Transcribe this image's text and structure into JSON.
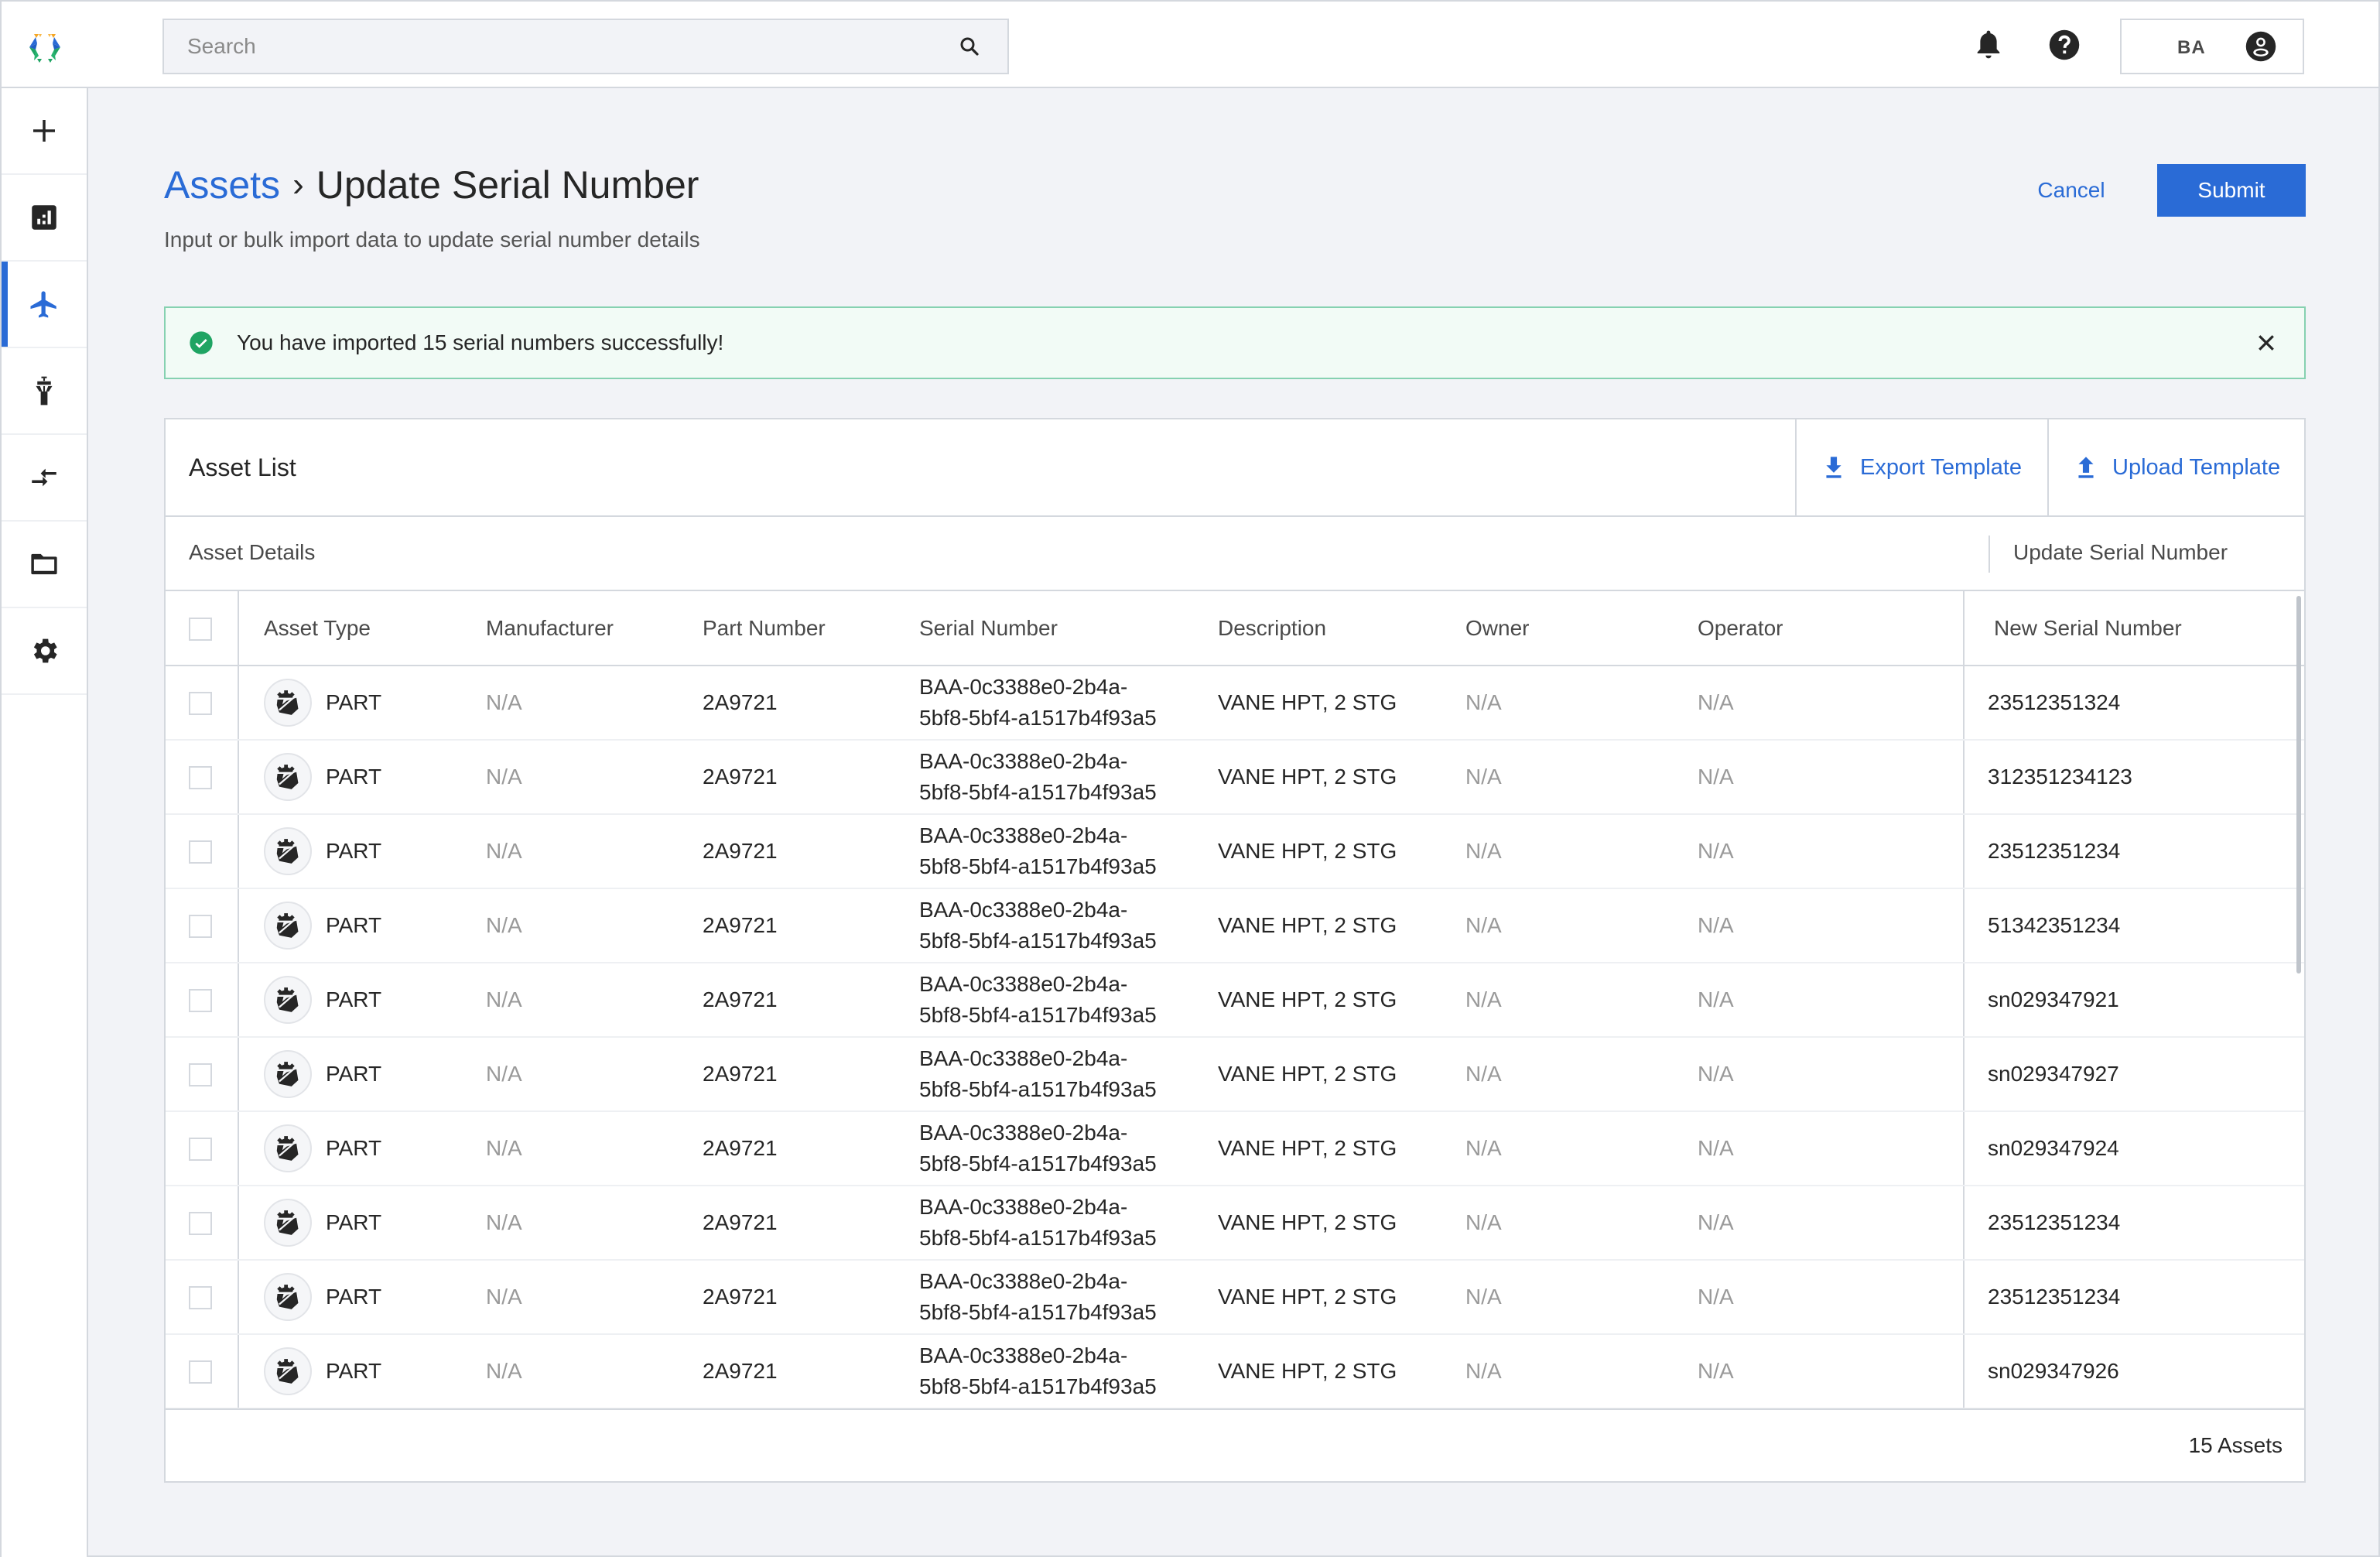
{
  "topbar": {
    "search_placeholder": "Search",
    "user_initials": "BA"
  },
  "sidebar": {
    "items": [
      {
        "name": "add",
        "icon": "plus-icon",
        "active": false
      },
      {
        "name": "dashboard",
        "icon": "chart-icon",
        "active": false
      },
      {
        "name": "flights",
        "icon": "airplane-icon",
        "active": true
      },
      {
        "name": "airports",
        "icon": "control-tower-icon",
        "active": false
      },
      {
        "name": "transfers",
        "icon": "swap-arrows-icon",
        "active": false
      },
      {
        "name": "files",
        "icon": "folder-icon",
        "active": false
      },
      {
        "name": "settings",
        "icon": "gear-icon",
        "active": false
      }
    ]
  },
  "header": {
    "breadcrumb_parent": "Assets",
    "breadcrumb_separator": "›",
    "title": "Update Serial Number",
    "subtitle": "Input or bulk import data to update serial number details",
    "cancel_label": "Cancel",
    "submit_label": "Submit"
  },
  "alert": {
    "message": "You have imported 15 serial numbers successfully!",
    "type": "success",
    "color": "#1fa463"
  },
  "card": {
    "title": "Asset List",
    "export_label": "Export Template",
    "upload_label": "Upload Template",
    "group_left": "Asset Details",
    "group_right": "Update Serial Number",
    "footer_count": "15 Assets"
  },
  "table": {
    "columns": [
      "Asset Type",
      "Manufacturer",
      "Part Number",
      "Serial Number",
      "Description",
      "Owner",
      "Operator",
      "New Serial Number"
    ],
    "rows": [
      {
        "type": "PART",
        "manufacturer": "N/A",
        "part": "2A9721",
        "serial_line1": "BAA-0c3388e0-2b4a-",
        "serial_line2": "5bf8-5bf4-a1517b4f93a5",
        "description": "VANE HPT, 2 STG",
        "owner": "N/A",
        "operator": "N/A",
        "new_serial": "23512351324"
      },
      {
        "type": "PART",
        "manufacturer": "N/A",
        "part": "2A9721",
        "serial_line1": "BAA-0c3388e0-2b4a-",
        "serial_line2": "5bf8-5bf4-a1517b4f93a5",
        "description": "VANE HPT, 2 STG",
        "owner": "N/A",
        "operator": "N/A",
        "new_serial": "312351234123"
      },
      {
        "type": "PART",
        "manufacturer": "N/A",
        "part": "2A9721",
        "serial_line1": "BAA-0c3388e0-2b4a-",
        "serial_line2": "5bf8-5bf4-a1517b4f93a5",
        "description": "VANE HPT, 2 STG",
        "owner": "N/A",
        "operator": "N/A",
        "new_serial": "23512351234"
      },
      {
        "type": "PART",
        "manufacturer": "N/A",
        "part": "2A9721",
        "serial_line1": "BAA-0c3388e0-2b4a-",
        "serial_line2": "5bf8-5bf4-a1517b4f93a5",
        "description": "VANE HPT, 2 STG",
        "owner": "N/A",
        "operator": "N/A",
        "new_serial": "51342351234"
      },
      {
        "type": "PART",
        "manufacturer": "N/A",
        "part": "2A9721",
        "serial_line1": "BAA-0c3388e0-2b4a-",
        "serial_line2": "5bf8-5bf4-a1517b4f93a5",
        "description": "VANE HPT, 2 STG",
        "owner": "N/A",
        "operator": "N/A",
        "new_serial": "sn029347921"
      },
      {
        "type": "PART",
        "manufacturer": "N/A",
        "part": "2A9721",
        "serial_line1": "BAA-0c3388e0-2b4a-",
        "serial_line2": "5bf8-5bf4-a1517b4f93a5",
        "description": "VANE HPT, 2 STG",
        "owner": "N/A",
        "operator": "N/A",
        "new_serial": "sn029347927"
      },
      {
        "type": "PART",
        "manufacturer": "N/A",
        "part": "2A9721",
        "serial_line1": "BAA-0c3388e0-2b4a-",
        "serial_line2": "5bf8-5bf4-a1517b4f93a5",
        "description": "VANE HPT, 2 STG",
        "owner": "N/A",
        "operator": "N/A",
        "new_serial": "sn029347924"
      },
      {
        "type": "PART",
        "manufacturer": "N/A",
        "part": "2A9721",
        "serial_line1": "BAA-0c3388e0-2b4a-",
        "serial_line2": "5bf8-5bf4-a1517b4f93a5",
        "description": "VANE HPT, 2 STG",
        "owner": "N/A",
        "operator": "N/A",
        "new_serial": "23512351234"
      },
      {
        "type": "PART",
        "manufacturer": "N/A",
        "part": "2A9721",
        "serial_line1": "BAA-0c3388e0-2b4a-",
        "serial_line2": "5bf8-5bf4-a1517b4f93a5",
        "description": "VANE HPT, 2 STG",
        "owner": "N/A",
        "operator": "N/A",
        "new_serial": "23512351234"
      },
      {
        "type": "PART",
        "manufacturer": "N/A",
        "part": "2A9721",
        "serial_line1": "BAA-0c3388e0-2b4a-",
        "serial_line2": "5bf8-5bf4-a1517b4f93a5",
        "description": "VANE HPT, 2 STG",
        "owner": "N/A",
        "operator": "N/A",
        "new_serial": "sn029347926"
      }
    ]
  },
  "colors": {
    "accent": "#2a6bd6",
    "success": "#1fa463",
    "alert_bg": "#f2fbf6",
    "alert_border": "#86d1b1",
    "page_bg": "#f2f3f7"
  }
}
